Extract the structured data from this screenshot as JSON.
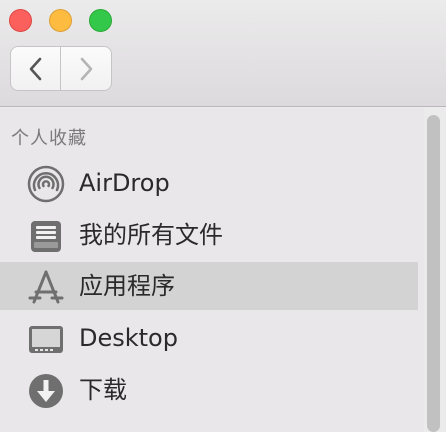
{
  "window": {
    "controls": [
      "close",
      "minimize",
      "maximize"
    ]
  },
  "toolbar": {
    "back_icon": "chevron-left-icon",
    "forward_icon": "chevron-right-icon"
  },
  "sidebar": {
    "section_title": "个人收藏",
    "items": [
      {
        "label": "AirDrop",
        "icon": "airdrop-icon",
        "selected": false
      },
      {
        "label": "我的所有文件",
        "icon": "all-files-icon",
        "selected": false
      },
      {
        "label": "应用程序",
        "icon": "applications-icon",
        "selected": true
      },
      {
        "label": "Desktop",
        "icon": "desktop-icon",
        "selected": false
      },
      {
        "label": "下载",
        "icon": "downloads-icon",
        "selected": false
      }
    ]
  },
  "colors": {
    "selection": "#d4d3d4",
    "icon": "#6f6f6f",
    "close": "#fc605c",
    "minimize": "#fdbc40",
    "maximize": "#34c84a"
  }
}
